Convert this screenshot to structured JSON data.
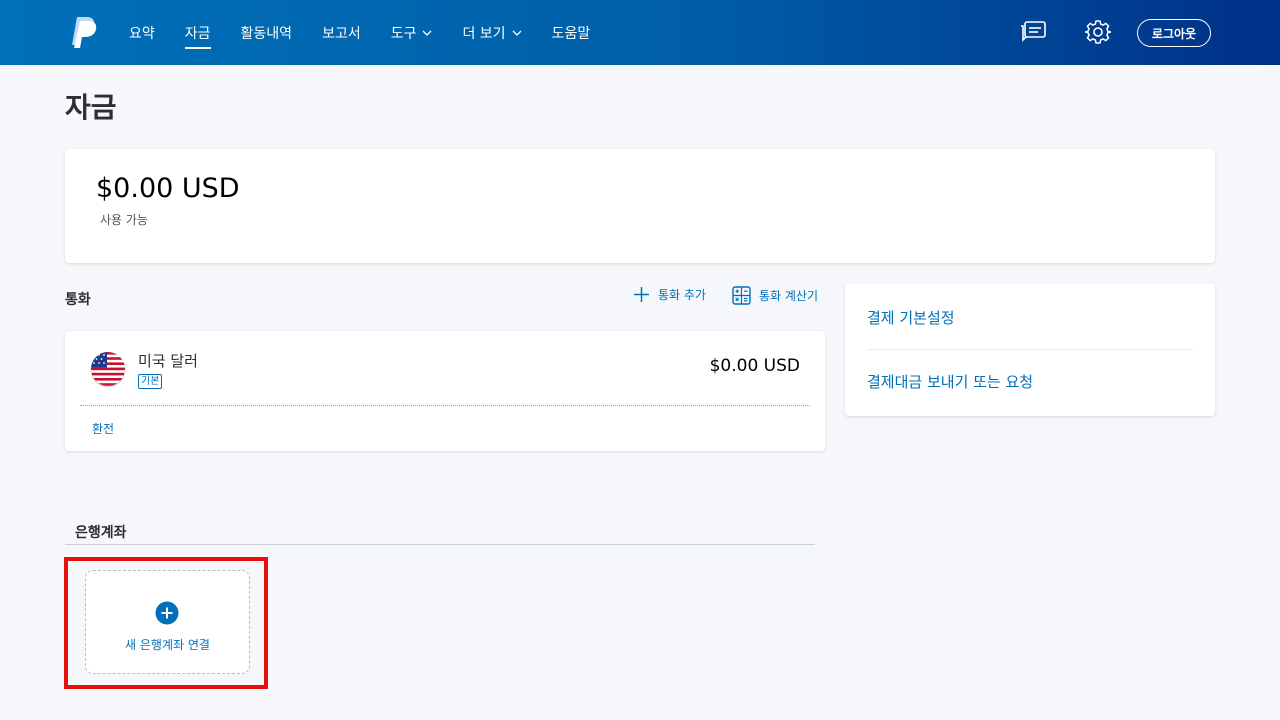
{
  "header": {
    "nav": [
      {
        "label": "요약",
        "active": false,
        "dropdown": false
      },
      {
        "label": "자금",
        "active": true,
        "dropdown": false
      },
      {
        "label": "활동내역",
        "active": false,
        "dropdown": false
      },
      {
        "label": "보고서",
        "active": false,
        "dropdown": false
      },
      {
        "label": "도구",
        "active": false,
        "dropdown": true
      },
      {
        "label": "더 보기",
        "active": false,
        "dropdown": true
      },
      {
        "label": "도움말",
        "active": false,
        "dropdown": false
      }
    ],
    "icons": [
      "paypal-logo",
      "messages-icon",
      "gear-icon"
    ],
    "logout_label": "로그아웃"
  },
  "page": {
    "title": "자금"
  },
  "balance": {
    "amount": "$0.00 USD",
    "label": "사용 가능"
  },
  "currencies": {
    "section_title": "통화",
    "add_currency_label": "통화 추가",
    "calculator_label": "통화 계산기",
    "items": [
      {
        "name": "미국 달러",
        "badge": "기본",
        "amount": "$0.00 USD",
        "flag": "us-flag-icon"
      }
    ],
    "convert_label": "환전"
  },
  "side_links": {
    "payment_settings": "결제 기본설정",
    "send_request": "결제대금 보내기 또는 요청"
  },
  "bank": {
    "section_title": "은행계좌",
    "add_label": "새 은행계좌 연결"
  },
  "colors": {
    "header_start": "#0070ba",
    "header_end": "#003087",
    "link": "#0070ba",
    "highlight": "#e6100e",
    "background": "#f5f7fa"
  }
}
